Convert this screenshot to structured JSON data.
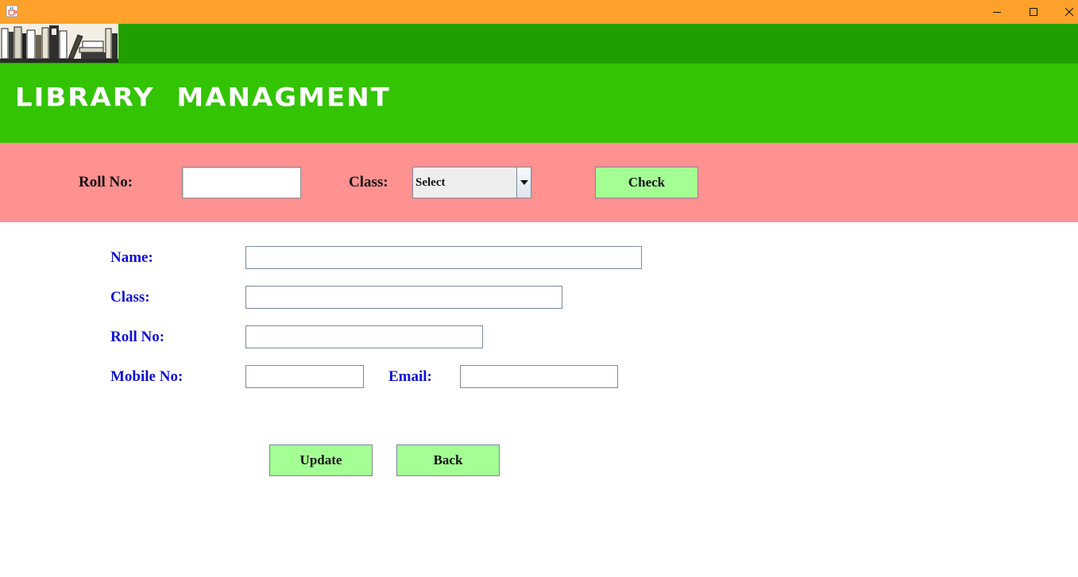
{
  "window": {
    "app_icon": "java-cup-icon",
    "controls": [
      "minimize-icon",
      "maximize-icon",
      "close-icon"
    ],
    "titlebar_color": "#ffa12b"
  },
  "header": {
    "image": "books-illustration",
    "title": "LIBRARY  MANAGMENT",
    "top_color": "#229f00",
    "title_band_color": "#33c404"
  },
  "search": {
    "roll_label": "Roll No:",
    "roll_value": "",
    "class_label": "Class:",
    "class_selected": "Select",
    "check_label": "Check",
    "band_color": "#ff9191"
  },
  "form": {
    "name_label": "Name:",
    "name_value": "",
    "class_label": "Class:",
    "class_value": "",
    "roll_label": "Roll No:",
    "roll_value": "",
    "mobile_label": "Mobile No:",
    "mobile_value": "",
    "email_label": "Email:",
    "email_value": "",
    "label_color": "#1010d8"
  },
  "actions": {
    "update_label": "Update",
    "back_label": "Back",
    "button_color": "#a3ff94"
  }
}
